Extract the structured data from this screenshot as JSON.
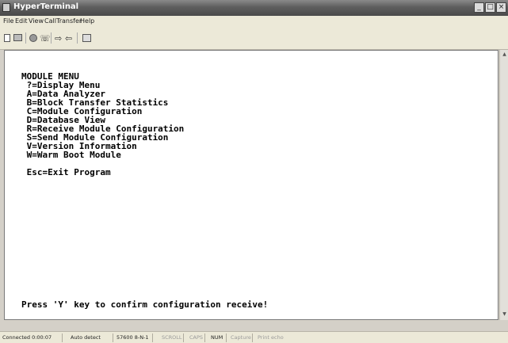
{
  "window": {
    "title": "HyperTerminal",
    "controls": {
      "minimize": "_",
      "maximize": "□",
      "close": "×"
    }
  },
  "menubar": [
    "File",
    "Edit",
    "View",
    "Call",
    "Transfer",
    "Help"
  ],
  "toolbar": {
    "icons": [
      "new-icon",
      "open-icon",
      "disconnect-icon",
      "dial-icon",
      "send-icon",
      "receive-icon",
      "properties-icon"
    ]
  },
  "terminal": {
    "lines": [
      "MODULE MENU",
      " ?=Display Menu",
      " A=Data Analyzer",
      " B=Block Transfer Statistics",
      " C=Module Configuration",
      " D=Database View",
      " R=Receive Module Configuration",
      " S=Send Module Configuration",
      " V=Version Information",
      " W=Warm Boot Module",
      "",
      " Esc=Exit Program"
    ],
    "prompt": "Press 'Y' key to confirm configuration receive!"
  },
  "statusbar": {
    "connected": "Connected 0:00:07",
    "detect": "Auto detect",
    "settings": "57600 8-N-1",
    "scroll": "SCROLL",
    "caps": "CAPS",
    "num": "NUM",
    "capture": "Capture",
    "print_echo": "Print echo"
  }
}
